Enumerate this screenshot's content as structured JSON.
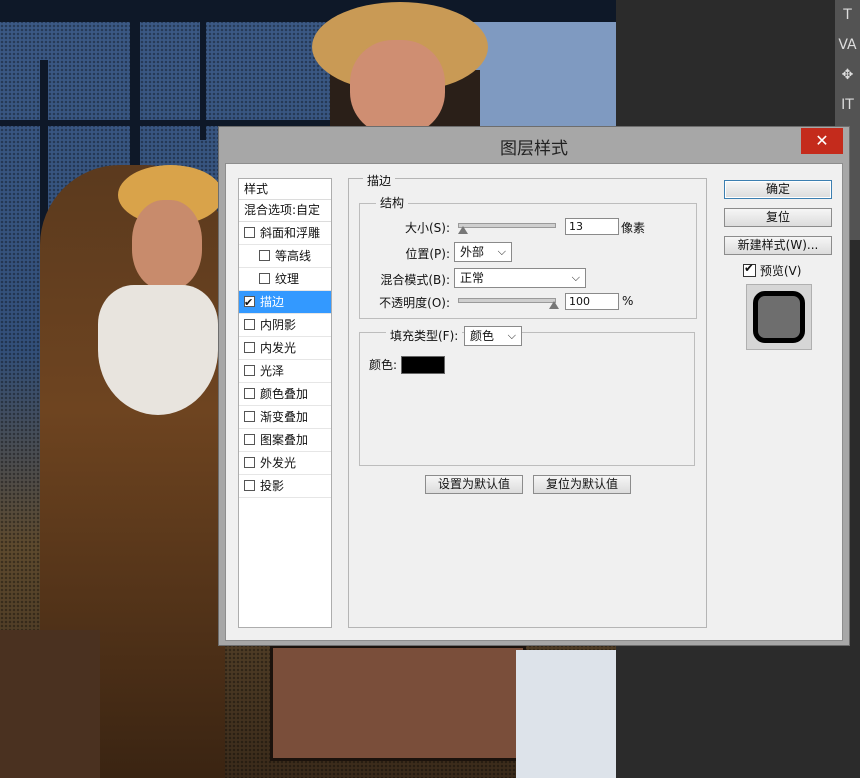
{
  "dialog": {
    "title": "图层样式",
    "close_glyph": "✕"
  },
  "styles_list": {
    "header": "样式",
    "blend_options": "混合选项:自定",
    "items": [
      {
        "label": "斜面和浮雕",
        "checked": false,
        "sub": false,
        "selected": false
      },
      {
        "label": "等高线",
        "checked": false,
        "sub": true,
        "selected": false
      },
      {
        "label": "纹理",
        "checked": false,
        "sub": true,
        "selected": false
      },
      {
        "label": "描边",
        "checked": true,
        "sub": false,
        "selected": true
      },
      {
        "label": "内阴影",
        "checked": false,
        "sub": false,
        "selected": false
      },
      {
        "label": "内发光",
        "checked": false,
        "sub": false,
        "selected": false
      },
      {
        "label": "光泽",
        "checked": false,
        "sub": false,
        "selected": false
      },
      {
        "label": "颜色叠加",
        "checked": false,
        "sub": false,
        "selected": false
      },
      {
        "label": "渐变叠加",
        "checked": false,
        "sub": false,
        "selected": false
      },
      {
        "label": "图案叠加",
        "checked": false,
        "sub": false,
        "selected": false
      },
      {
        "label": "外发光",
        "checked": false,
        "sub": false,
        "selected": false
      },
      {
        "label": "投影",
        "checked": false,
        "sub": false,
        "selected": false
      }
    ]
  },
  "stroke": {
    "group_title": "描边",
    "structure_title": "结构",
    "size_label": "大小(S):",
    "size_value": "13",
    "size_unit": "像素",
    "size_fraction": 0.05,
    "position_label": "位置(P):",
    "position_value": "外部",
    "blend_mode_label": "混合模式(B):",
    "blend_mode_value": "正常",
    "opacity_label": "不透明度(O):",
    "opacity_value": "100",
    "opacity_unit": "%",
    "opacity_fraction": 1.0,
    "fill_type_label": "填充类型(F):",
    "fill_type_value": "颜色",
    "color_label": "颜色:",
    "color_value": "#000000",
    "set_default_button": "设置为默认值",
    "reset_default_button": "复位为默认值"
  },
  "buttons": {
    "ok": "确定",
    "reset": "复位",
    "new_style": "新建样式(W)...",
    "preview_label": "预览(V)",
    "preview_checked": true
  },
  "side_panel": {
    "icons": [
      "type-icon",
      "tracking-icon",
      "transform-icon",
      "type-vertical-icon"
    ]
  }
}
